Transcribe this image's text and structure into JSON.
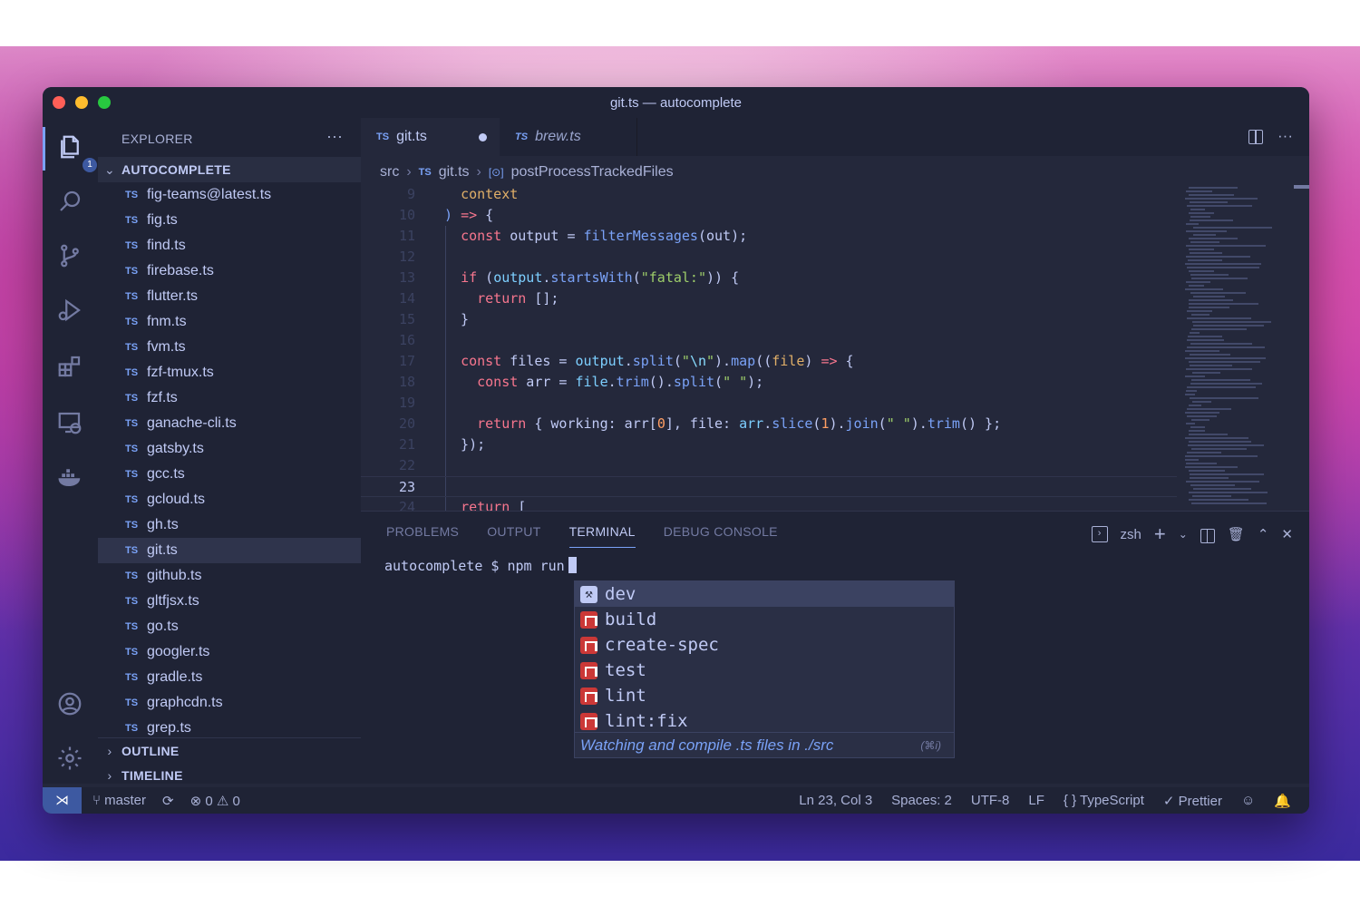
{
  "window": {
    "title": "git.ts — autocomplete"
  },
  "activity": {
    "explorer_badge": "1"
  },
  "sidebar": {
    "header": "EXPLORER",
    "more": "···",
    "root": "AUTOCOMPLETE",
    "files": [
      "fig-teams@latest.ts",
      "fig.ts",
      "find.ts",
      "firebase.ts",
      "flutter.ts",
      "fnm.ts",
      "fvm.ts",
      "fzf-tmux.ts",
      "fzf.ts",
      "ganache-cli.ts",
      "gatsby.ts",
      "gcc.ts",
      "gcloud.ts",
      "gh.ts",
      "git.ts",
      "github.ts",
      "gltfjsx.ts",
      "go.ts",
      "googler.ts",
      "gradle.ts",
      "graphcdn.ts",
      "grep.ts"
    ],
    "file_type_label": "TS",
    "selected_file": "git.ts",
    "outline": "OUTLINE",
    "timeline": "TIMELINE"
  },
  "tabs": [
    {
      "type": "TS",
      "name": "git.ts",
      "modified": true
    },
    {
      "type": "TS",
      "name": "brew.ts",
      "modified": false
    }
  ],
  "breadcrumb": {
    "folder": "src",
    "file_type": "TS",
    "file": "git.ts",
    "symbol": "postProcessTrackedFiles"
  },
  "editor": {
    "current_line": 23,
    "line_numbers": [
      "9",
      "10",
      "11",
      "12",
      "13",
      "14",
      "15",
      "16",
      "17",
      "18",
      "19",
      "20",
      "21",
      "22",
      "23",
      "24"
    ]
  },
  "panel": {
    "tabs": [
      "PROBLEMS",
      "OUTPUT",
      "TERMINAL",
      "DEBUG CONSOLE"
    ],
    "active_tab": "TERMINAL",
    "shell": "zsh",
    "prompt": "autocomplete $ npm run"
  },
  "autocomplete": {
    "items": [
      "dev",
      "build",
      "create-spec",
      "test",
      "lint",
      "lint:fix"
    ],
    "selected": "dev",
    "description": "Watching and compile .ts files in ./src",
    "shortcut": "(⌘i)"
  },
  "statusbar": {
    "branch": "master",
    "errors": "0",
    "warnings": "0",
    "position": "Ln 23, Col 3",
    "spaces": "Spaces: 2",
    "encoding": "UTF-8",
    "eol": "LF",
    "language": "TypeScript",
    "formatter": "Prettier"
  },
  "colors": {
    "background": "#24283b",
    "sidebar": "#1f2335",
    "accent": "#7aa2f7",
    "keyword": "#f7768e",
    "string": "#9ece6a"
  }
}
